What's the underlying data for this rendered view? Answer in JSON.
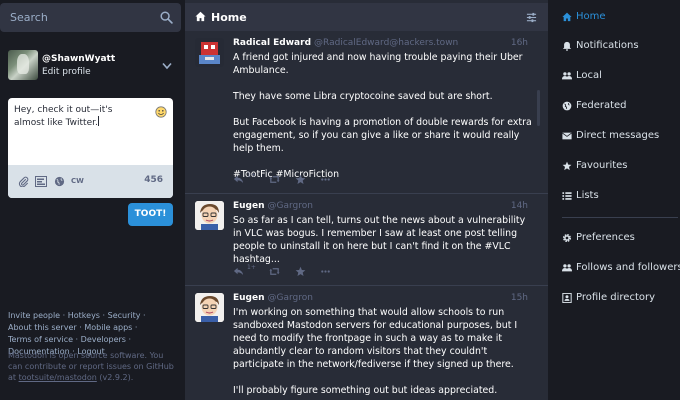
{
  "search": {
    "placeholder": "Search"
  },
  "profile": {
    "acct": "@ShawnWyatt",
    "edit_label": "Edit profile"
  },
  "compose": {
    "text": "Hey, check it out—it's almost like Twitter.",
    "cw_label": "CW",
    "char_count": "456",
    "submit_label": "TOOT!"
  },
  "footer": {
    "links": [
      "Invite people",
      "Hotkeys",
      "Security",
      "About this server",
      "Mobile apps",
      "Terms of service",
      "Developers",
      "Documentation",
      "Logout"
    ],
    "note": "Mastodon is open source software. You can contribute or report issues on GitHub at",
    "repo": "tootsuite/mastodon",
    "version": "(v2.9.2)."
  },
  "column": {
    "title": "Home"
  },
  "statuses": [
    {
      "display_name": "Radical Edward",
      "handle": "@RadicalEdward@hackers.town",
      "time": "16h",
      "paragraphs": [
        "A friend got injured and now having trouble paying their Uber Ambulance.",
        "They have some Libra cryptocoine saved but are short.",
        "But Facebook is having a promotion of double rewards for extra engagement, so if you can give a like or share it would really help them.",
        "#TootFic #MicroFiction"
      ],
      "reply_count": "1+"
    },
    {
      "display_name": "Eugen",
      "handle": "@Gargron",
      "time": "14h",
      "paragraphs": [
        "So as far as I can tell, turns out the news about a vulnerability in VLC was bogus. I remember I saw at least one post telling people to uninstall it on here but I can't find it on the #VLC hashtag..."
      ],
      "reply_count": "1+"
    },
    {
      "display_name": "Eugen",
      "handle": "@Gargron",
      "time": "15h",
      "paragraphs": [
        "I'm working on something that would allow schools to run sandboxed Mastodon servers for educational purposes, but I need to modify the frontpage in such a way as to make it abundantly clear to random visitors that they couldn't participate in the network/fediverse if they signed up there.",
        "I'll probably figure something out but ideas appreciated."
      ]
    }
  ],
  "nav": {
    "items": [
      "Home",
      "Notifications",
      "Local",
      "Federated",
      "Direct messages",
      "Favourites",
      "Lists",
      "Preferences",
      "Follows and followers",
      "Profile directory"
    ],
    "active": "Home"
  },
  "colors": {
    "accent": "#2b90d9",
    "background": "#191b22",
    "panel": "#282c37",
    "header": "#313543",
    "muted": "#606984",
    "secondary": "#9baec8"
  }
}
